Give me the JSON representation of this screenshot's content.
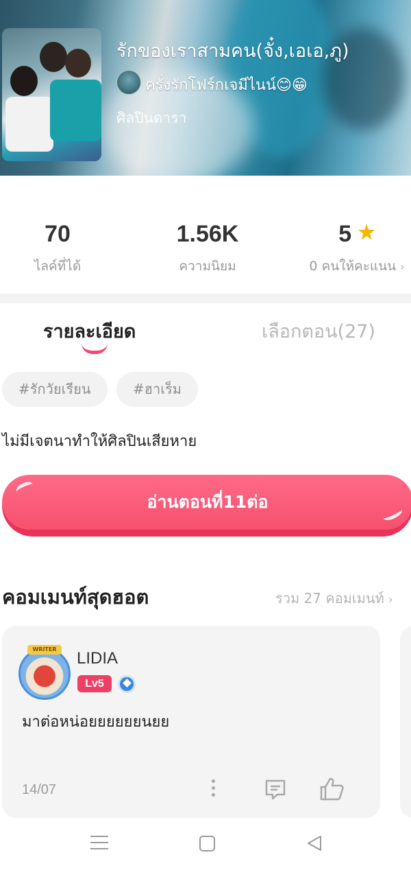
{
  "story": {
    "title": "รักของเราสามคน(จั๋ง,เอเอ,ภู)",
    "author": "ครั่งรักโฟร์กเจมีไนน์😊😁",
    "category": "ศิลปินดารา"
  },
  "stats": {
    "likes_value": "70",
    "likes_label": "ไลค์ที่ได้",
    "popularity_value": "1.56K",
    "popularity_label": "ความนิยม",
    "rating_value": "5",
    "rating_label": "0 คนให้คะแนน",
    "rating_icon": "star-icon"
  },
  "tabs": {
    "details": "รายละเอียด",
    "episodes": "เลือกตอน(27)"
  },
  "tags": [
    "#รักวัยเรียน",
    "#ฮาเร็ม"
  ],
  "description": "ไม่มีเจตนาทำให้ศิลปินเสียหาย",
  "read_button": "อ่านตอนที่11ต่อ",
  "comments_section": {
    "title": "คอมเมนท์สุดฮอต",
    "total": "รวม 27 คอมเมนท์"
  },
  "comment": {
    "user": "LIDIA",
    "level": "Lv5",
    "avatar_badge": "WRITER",
    "text": "มาต่อหน่อยยยยยยนยย",
    "date": "14/07"
  },
  "colors": {
    "accent": "#f6516f",
    "star": "#f7b500",
    "level_badge": "#ee3f64"
  }
}
